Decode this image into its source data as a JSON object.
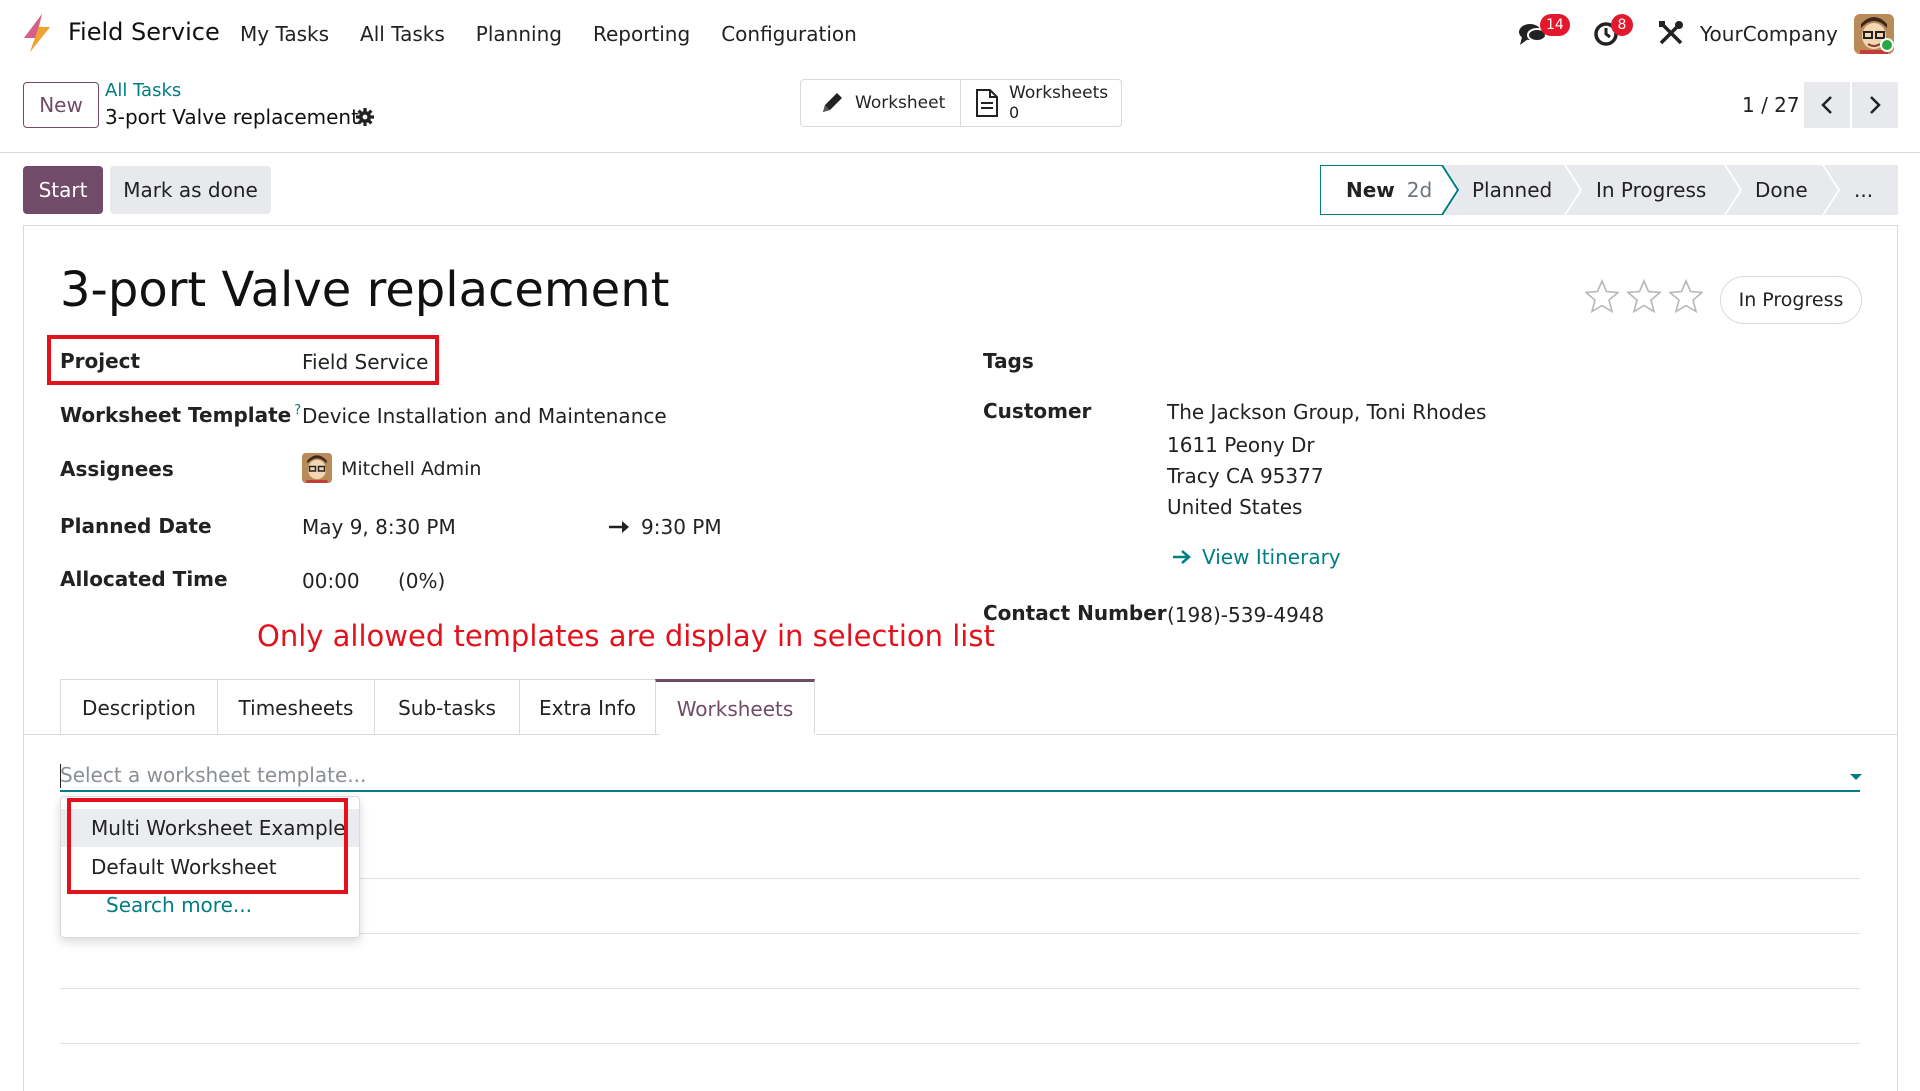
{
  "navbar": {
    "app_name": "Field Service",
    "menu": [
      "My Tasks",
      "All Tasks",
      "Planning",
      "Reporting",
      "Configuration"
    ],
    "messages_badge": "14",
    "activities_badge": "8",
    "company": "YourCompany",
    "icons": [
      "field-service-logo-icon",
      "chat-icon",
      "clock-icon",
      "tools-icon",
      "user-avatar"
    ]
  },
  "control_panel": {
    "new_label": "New",
    "breadcrumb": "All Tasks",
    "record_name": "3-port Valve replacement",
    "smart_buttons": {
      "worksheet_label": "Worksheet",
      "worksheets_label": "Worksheets",
      "worksheets_count": "0"
    },
    "pager": "1 / 27"
  },
  "status_bar": {
    "start_label": "Start",
    "mark_done_label": "Mark as done",
    "stages": [
      {
        "label": "New",
        "badge": "2d",
        "active": true
      },
      {
        "label": "Planned"
      },
      {
        "label": "In Progress"
      },
      {
        "label": "Done"
      },
      {
        "label": "..."
      }
    ]
  },
  "form": {
    "title": "3-port Valve replacement",
    "priority_stars": 3,
    "state": "In Progress",
    "left": {
      "project_label": "Project",
      "project_value": "Field Service",
      "template_label": "Worksheet Template",
      "template_help": "?",
      "template_value": "Device Installation and Maintenance",
      "assignees_label": "Assignees",
      "assignee_name": "Mitchell Admin",
      "planned_label": "Planned Date",
      "planned_start": "May 9, 8:30 PM",
      "planned_end": "9:30 PM",
      "allocated_label": "Allocated Time",
      "allocated_value": "00:00",
      "allocated_percent": "(0%)"
    },
    "right": {
      "tags_label": "Tags",
      "customer_label": "Customer",
      "customer_lines": [
        "The Jackson Group, Toni Rhodes",
        "1611 Peony Dr",
        "Tracy CA 95377",
        "United States"
      ],
      "itinerary_label": "View Itinerary",
      "contact_label": "Contact Number",
      "contact_value": "(198)-539-4948"
    }
  },
  "annotation": "Only allowed templates are display in selection list",
  "tabs": [
    {
      "label": "Description",
      "active": false
    },
    {
      "label": "Timesheets",
      "active": false
    },
    {
      "label": "Sub-tasks",
      "active": false
    },
    {
      "label": "Extra Info",
      "active": false
    },
    {
      "label": "Worksheets",
      "active": true
    }
  ],
  "worksheet_select": {
    "placeholder": "Select a worksheet template...",
    "options": [
      "Multi Worksheet Example",
      "Default Worksheet"
    ],
    "search_more": "Search more..."
  },
  "colors": {
    "brand": "#714b67",
    "link": "#017e84",
    "badge": "#e3182d",
    "annotation_red": "#e3111c"
  }
}
